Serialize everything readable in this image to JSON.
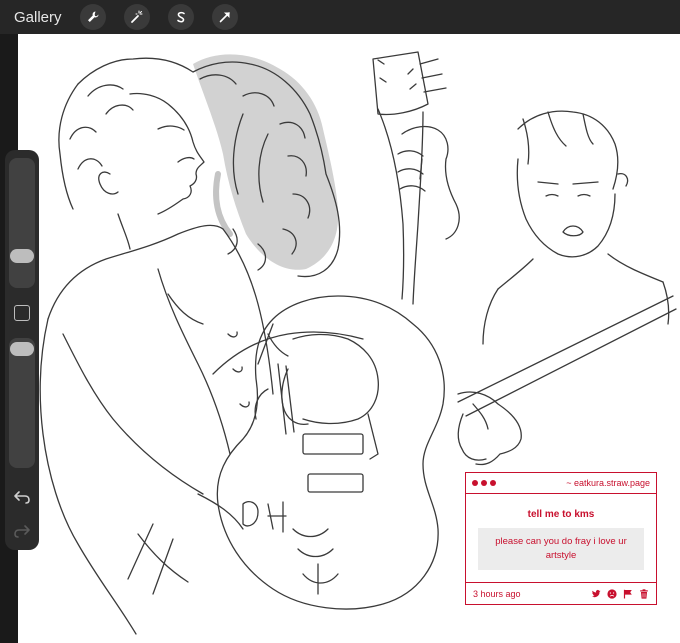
{
  "topbar": {
    "gallery_label": "Gallery",
    "tools": [
      "wrench-icon",
      "magic-wand-icon",
      "selection-s-icon",
      "arrow-icon"
    ]
  },
  "sidebar": {
    "controls": [
      "brush-size-slider",
      "modify-button",
      "opacity-slider",
      "undo-icon",
      "redo-icon"
    ]
  },
  "card": {
    "site": "~ eatkura.straw.page",
    "title": "tell me to kms",
    "message": "please can you do fray i love ur artstyle",
    "time": "3 hours ago",
    "actions": [
      "twitter-icon",
      "frown-icon",
      "flag-icon",
      "trash-icon"
    ],
    "accent": "#c8102e"
  },
  "colors": {
    "toolbar": "#262626",
    "canvas": "#ffffff",
    "sketch": "#3a3a3a"
  }
}
